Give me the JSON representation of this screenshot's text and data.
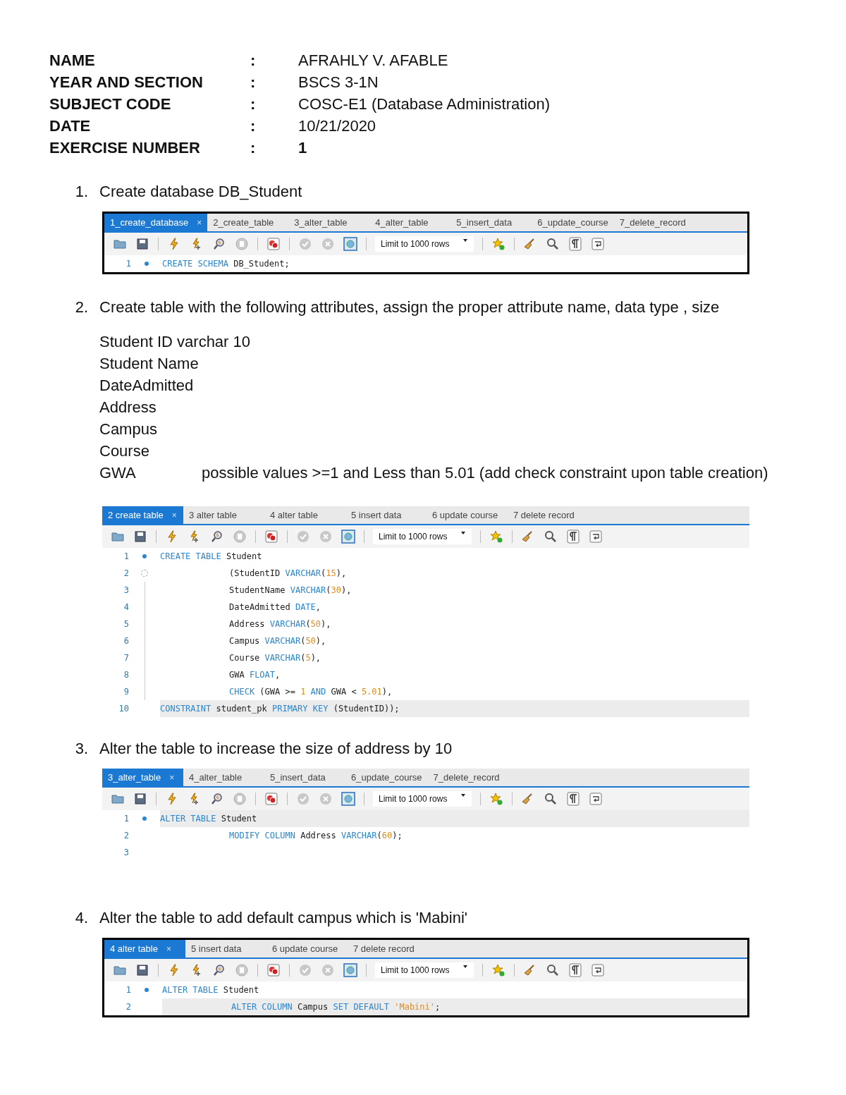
{
  "header": [
    {
      "label": "NAME",
      "separator": ":",
      "value": "AFRAHLY V. AFABLE",
      "bold": false
    },
    {
      "label": "YEAR AND SECTION",
      "separator": ":",
      "value": "BSCS 3-1N",
      "bold": false
    },
    {
      "label": "SUBJECT CODE",
      "separator": ":",
      "value": "COSC-E1 (Database Administration)",
      "bold": false
    },
    {
      "label": "DATE",
      "separator": ":",
      "value": "10/21/2020",
      "bold": false
    },
    {
      "label": "EXERCISE NUMBER",
      "separator": ":",
      "value": "1",
      "bold": true
    }
  ],
  "items": [
    {
      "number": "1.",
      "text": "Create database DB_Student",
      "editor": {
        "framed": true,
        "tabs": [
          {
            "label": "1_create_database",
            "selected": true
          },
          {
            "label": "2_create_table",
            "selected": false
          },
          {
            "label": "3_alter_table",
            "selected": false
          },
          {
            "label": "4_alter_table",
            "selected": false
          },
          {
            "label": "5_insert_data",
            "selected": false
          },
          {
            "label": "6_update_course",
            "selected": false
          },
          {
            "label": "7_delete_record",
            "selected": false
          }
        ],
        "close": "×",
        "limit": "Limit to 1000 rows",
        "lines": [
          {
            "number": "1",
            "breakpoint": true,
            "fold": false,
            "in_fold": false,
            "current": false,
            "indented": false,
            "tokens": [
              {
                "kind": "keyword",
                "text": "CREATE SCHEMA "
              },
              {
                "kind": "ident",
                "text": "DB_Student;"
              }
            ]
          }
        ]
      }
    },
    {
      "number": "2.",
      "text": "Create table with the following attributes, assign the proper attribute name, data type , size",
      "attributes": [
        {
          "name": "Student ID  varchar 10"
        },
        {
          "name": "Student Name"
        },
        {
          "name": "DateAdmitted"
        },
        {
          "name": "Address"
        },
        {
          "name": "Campus"
        },
        {
          "name": "Course"
        },
        {
          "name": "GWA",
          "note": "possible values >=1  and Less than 5.01 (add check constraint upon table creation)"
        }
      ],
      "editor": {
        "framed": false,
        "tabs": [
          {
            "label": "2 create table",
            "selected": true
          },
          {
            "label": "3 alter table",
            "selected": false
          },
          {
            "label": "4 alter table",
            "selected": false
          },
          {
            "label": "5 insert data",
            "selected": false
          },
          {
            "label": "6 update course",
            "selected": false
          },
          {
            "label": "7 delete record",
            "selected": false
          }
        ],
        "close": "×",
        "limit": "Limit to 1000 rows",
        "lines": [
          {
            "number": "1",
            "breakpoint": true,
            "fold": false,
            "in_fold": false,
            "current": false,
            "indented": false,
            "tokens": [
              {
                "kind": "keyword",
                "text": "CREATE TABLE "
              },
              {
                "kind": "ident",
                "text": "Student"
              }
            ]
          },
          {
            "number": "2",
            "breakpoint": false,
            "fold": true,
            "in_fold": false,
            "current": false,
            "indented": true,
            "tokens": [
              {
                "kind": "ident",
                "text": "(StudentID "
              },
              {
                "kind": "keyword",
                "text": "VARCHAR"
              },
              {
                "kind": "ident",
                "text": "("
              },
              {
                "kind": "number",
                "text": "15"
              },
              {
                "kind": "ident",
                "text": "),"
              }
            ]
          },
          {
            "number": "3",
            "breakpoint": false,
            "fold": false,
            "in_fold": true,
            "current": false,
            "indented": true,
            "tokens": [
              {
                "kind": "ident",
                "text": "StudentName "
              },
              {
                "kind": "keyword",
                "text": "VARCHAR"
              },
              {
                "kind": "ident",
                "text": "("
              },
              {
                "kind": "number",
                "text": "30"
              },
              {
                "kind": "ident",
                "text": "),"
              }
            ]
          },
          {
            "number": "4",
            "breakpoint": false,
            "fold": false,
            "in_fold": true,
            "current": false,
            "indented": true,
            "tokens": [
              {
                "kind": "ident",
                "text": "DateAdmitted "
              },
              {
                "kind": "keyword",
                "text": "DATE"
              },
              {
                "kind": "ident",
                "text": ","
              }
            ]
          },
          {
            "number": "5",
            "breakpoint": false,
            "fold": false,
            "in_fold": true,
            "current": false,
            "indented": true,
            "tokens": [
              {
                "kind": "ident",
                "text": "Address "
              },
              {
                "kind": "keyword",
                "text": "VARCHAR"
              },
              {
                "kind": "ident",
                "text": "("
              },
              {
                "kind": "number",
                "text": "50"
              },
              {
                "kind": "ident",
                "text": "),"
              }
            ]
          },
          {
            "number": "6",
            "breakpoint": false,
            "fold": false,
            "in_fold": true,
            "current": false,
            "indented": true,
            "tokens": [
              {
                "kind": "ident",
                "text": "Campus "
              },
              {
                "kind": "keyword",
                "text": "VARCHAR"
              },
              {
                "kind": "ident",
                "text": "("
              },
              {
                "kind": "number",
                "text": "50"
              },
              {
                "kind": "ident",
                "text": "),"
              }
            ]
          },
          {
            "number": "7",
            "breakpoint": false,
            "fold": false,
            "in_fold": true,
            "current": false,
            "indented": true,
            "tokens": [
              {
                "kind": "ident",
                "text": "Course "
              },
              {
                "kind": "keyword",
                "text": "VARCHAR"
              },
              {
                "kind": "ident",
                "text": "("
              },
              {
                "kind": "number",
                "text": "5"
              },
              {
                "kind": "ident",
                "text": "),"
              }
            ]
          },
          {
            "number": "8",
            "breakpoint": false,
            "fold": false,
            "in_fold": true,
            "current": false,
            "indented": true,
            "tokens": [
              {
                "kind": "ident",
                "text": "GWA "
              },
              {
                "kind": "keyword",
                "text": "FLOAT"
              },
              {
                "kind": "ident",
                "text": ","
              }
            ]
          },
          {
            "number": "9",
            "breakpoint": false,
            "fold": false,
            "in_fold": true,
            "current": false,
            "indented": true,
            "tokens": [
              {
                "kind": "keyword",
                "text": "CHECK "
              },
              {
                "kind": "ident",
                "text": "(GWA >= "
              },
              {
                "kind": "number",
                "text": "1 "
              },
              {
                "kind": "keyword",
                "text": "AND "
              },
              {
                "kind": "ident",
                "text": "GWA < "
              },
              {
                "kind": "number",
                "text": "5.01"
              },
              {
                "kind": "ident",
                "text": "),"
              }
            ]
          },
          {
            "number": "10",
            "breakpoint": false,
            "fold": false,
            "in_fold": false,
            "current": true,
            "indented": false,
            "tokens": [
              {
                "kind": "keyword",
                "text": "CONSTRAINT "
              },
              {
                "kind": "ident",
                "text": "student_pk "
              },
              {
                "kind": "keyword",
                "text": "PRIMARY KEY "
              },
              {
                "kind": "ident",
                "text": "(StudentID));"
              }
            ]
          }
        ]
      }
    },
    {
      "number": "3.",
      "text": "Alter the table to increase the size of address by 10",
      "editor": {
        "framed": false,
        "tabs": [
          {
            "label": "3_alter_table",
            "selected": true
          },
          {
            "label": "4_alter_table",
            "selected": false
          },
          {
            "label": "5_insert_data",
            "selected": false
          },
          {
            "label": "6_update_course",
            "selected": false
          },
          {
            "label": "7_delete_record",
            "selected": false
          }
        ],
        "close": "×",
        "limit": "Limit to 1000 rows",
        "lines": [
          {
            "number": "1",
            "breakpoint": true,
            "fold": false,
            "in_fold": false,
            "current": true,
            "indented": false,
            "tokens": [
              {
                "kind": "keyword",
                "text": "ALTER TABLE "
              },
              {
                "kind": "ident",
                "text": "Student"
              }
            ]
          },
          {
            "number": "2",
            "breakpoint": false,
            "fold": false,
            "in_fold": false,
            "current": false,
            "indented": true,
            "tokens": [
              {
                "kind": "keyword",
                "text": "MODIFY COLUMN "
              },
              {
                "kind": "ident",
                "text": "Address "
              },
              {
                "kind": "keyword",
                "text": "VARCHAR"
              },
              {
                "kind": "ident",
                "text": "("
              },
              {
                "kind": "number",
                "text": "60"
              },
              {
                "kind": "ident",
                "text": ");"
              }
            ]
          },
          {
            "number": "3",
            "breakpoint": false,
            "fold": false,
            "in_fold": false
          }
        ]
      }
    },
    {
      "number": "4.",
      "text": "Alter the table to add default campus which is 'Mabini'",
      "editor": {
        "framed": true,
        "tabs": [
          {
            "label": "4 alter table",
            "selected": true
          },
          {
            "label": "5 insert data",
            "selected": false
          },
          {
            "label": "6 update course",
            "selected": false
          },
          {
            "label": "7 delete record",
            "selected": false
          }
        ],
        "close": "×",
        "limit": "Limit to 1000 rows",
        "lines": [
          {
            "number": "1",
            "breakpoint": true,
            "fold": false,
            "in_fold": false,
            "current": false,
            "indented": false,
            "tokens": [
              {
                "kind": "keyword",
                "text": "ALTER TABLE "
              },
              {
                "kind": "ident",
                "text": "Student"
              }
            ]
          },
          {
            "number": "2",
            "breakpoint": false,
            "fold": false,
            "in_fold": false,
            "current": true,
            "indented": true,
            "tokens": [
              {
                "kind": "keyword",
                "text": "ALTER COLUMN "
              },
              {
                "kind": "ident",
                "text": "Campus "
              },
              {
                "kind": "keyword",
                "text": "SET DEFAULT "
              },
              {
                "kind": "string",
                "text": "'Mabini'"
              },
              {
                "kind": "ident",
                "text": ";"
              }
            ]
          }
        ]
      }
    }
  ]
}
